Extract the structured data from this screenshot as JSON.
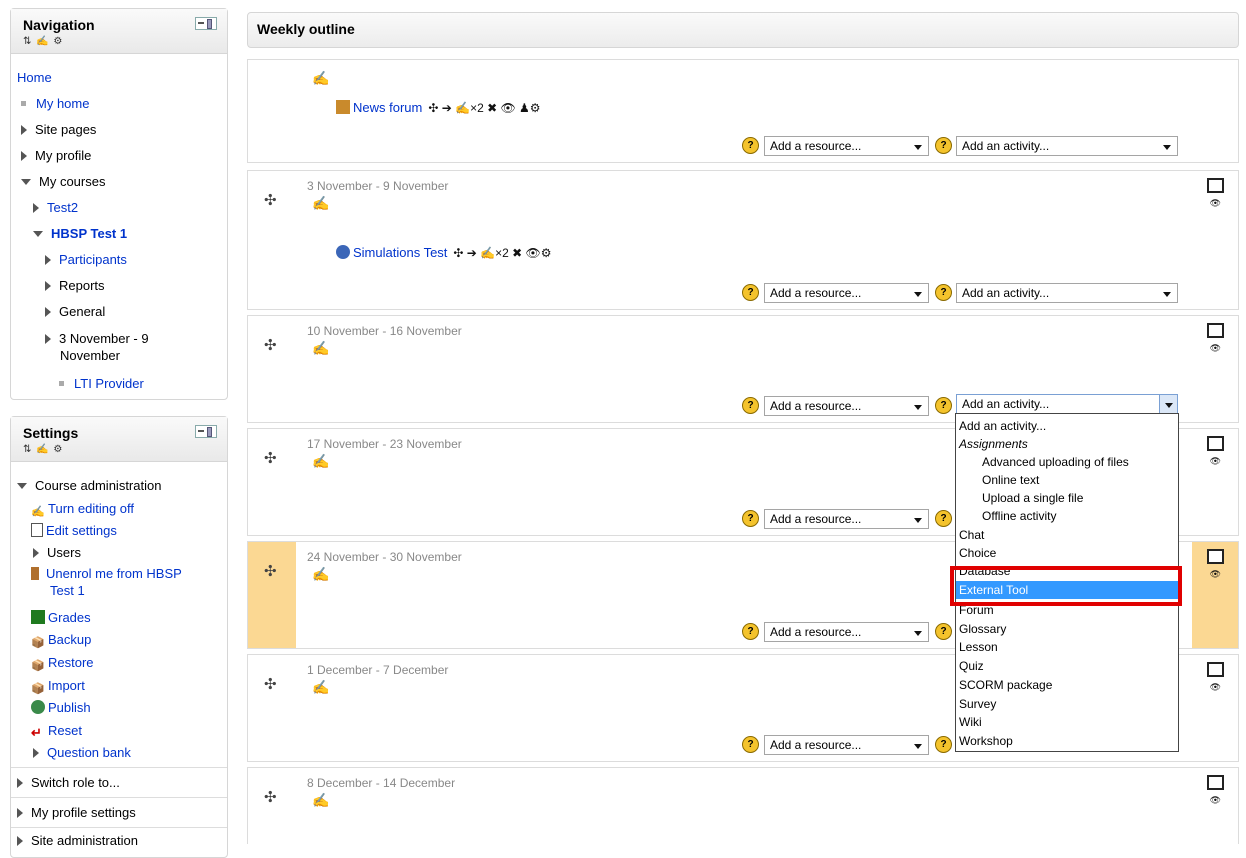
{
  "navigation": {
    "title": "Navigation",
    "home": "Home",
    "my_home": "My home",
    "site_pages": "Site pages",
    "my_profile": "My profile",
    "my_courses": "My courses",
    "test2": "Test2",
    "hbsp": "HBSP Test 1",
    "participants": "Participants",
    "reports": "Reports",
    "general": "General",
    "week1_line1": "3 November - 9",
    "week1_line2": "November",
    "lti": "LTI Provider"
  },
  "settings": {
    "title": "Settings",
    "course_admin": "Course administration",
    "turn_editing": "Turn editing off",
    "edit_settings": "Edit settings",
    "users": "Users",
    "unenrol_line1": "Unenrol me from HBSP",
    "unenrol_line2": "Test 1",
    "grades": "Grades",
    "backup": "Backup",
    "restore": "Restore",
    "import": "Import",
    "publish": "Publish",
    "reset": "Reset",
    "question_bank": "Question bank",
    "switch_role": "Switch role to...",
    "profile_settings": "My profile settings",
    "site_admin": "Site administration"
  },
  "outline": {
    "title": "Weekly outline",
    "news_forum": "News forum",
    "simulations": "Simulations Test",
    "add_resource": "Add a resource...",
    "add_activity": "Add an activity...",
    "weeks": [
      "3 November - 9 November",
      "10 November - 16 November",
      "17 November - 23 November",
      "24 November - 30 November",
      "1 December - 7 December",
      "8 December - 14 December"
    ]
  },
  "activity_dropdown": {
    "options": [
      "Add an activity...",
      "Assignments",
      "Advanced uploading of files",
      "Online text",
      "Upload a single file",
      "Offline activity",
      "Chat",
      "Choice",
      "Database",
      "External Tool",
      "Forum",
      "Glossary",
      "Lesson",
      "Quiz",
      "SCORM package",
      "Survey",
      "Wiki",
      "Workshop"
    ],
    "selected": "External Tool"
  }
}
